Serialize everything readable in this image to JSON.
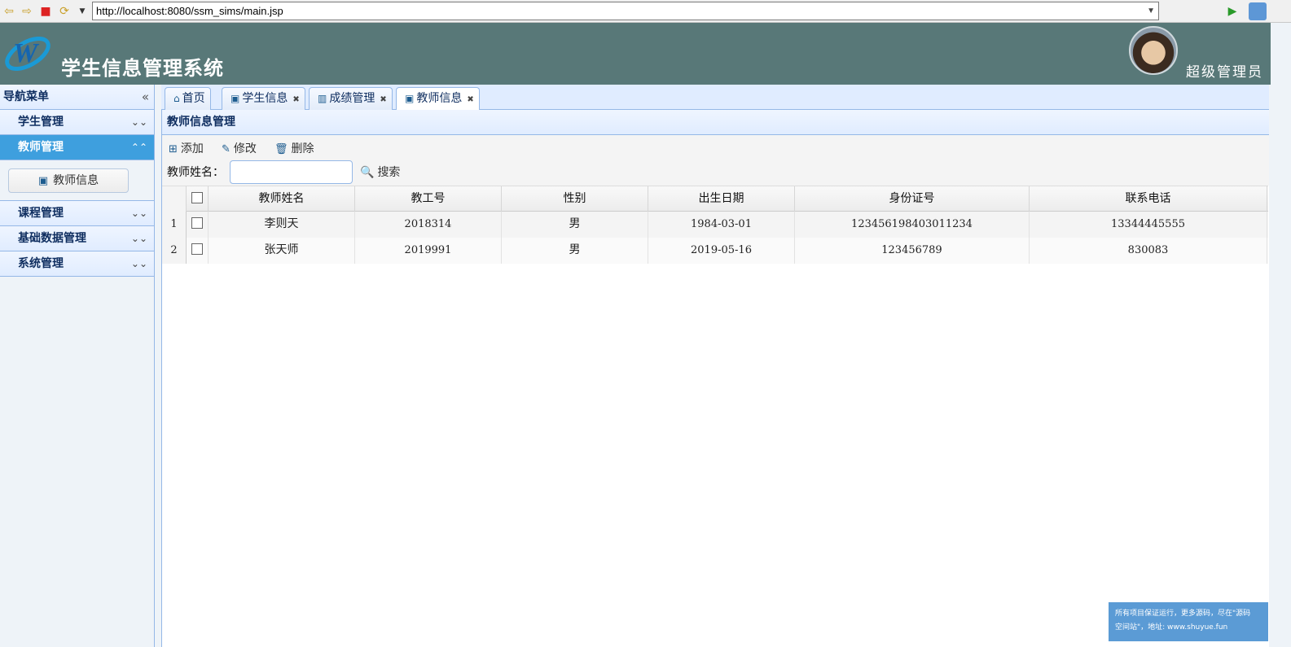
{
  "browser": {
    "url": "http://localhost:8080/ssm_sims/main.jsp"
  },
  "header": {
    "title": "学生信息管理系统",
    "user_role": "超级管理员"
  },
  "sidebar": {
    "title": "导航菜单",
    "groups": [
      {
        "label": "学生管理"
      },
      {
        "label": "教师管理",
        "items": [
          {
            "label": "教师信息"
          }
        ]
      },
      {
        "label": "课程管理"
      },
      {
        "label": "基础数据管理"
      },
      {
        "label": "系统管理"
      }
    ]
  },
  "tabs": [
    {
      "label": "首页"
    },
    {
      "label": "学生信息"
    },
    {
      "label": "成绩管理"
    },
    {
      "label": "教师信息"
    }
  ],
  "panel": {
    "title": "教师信息管理",
    "toolbar": {
      "add": "添加",
      "edit": "修改",
      "delete": "删除",
      "search_label": "教师姓名：",
      "search_value": "",
      "search_btn": "搜索"
    }
  },
  "grid": {
    "columns": [
      "教师姓名",
      "教工号",
      "性别",
      "出生日期",
      "身份证号",
      "联系电话"
    ],
    "rows": [
      {
        "n": "1",
        "name": "李则天",
        "id": "2018314",
        "gender": "男",
        "birth": "1984-03-01",
        "idcard": "123456198403011234",
        "phone": "13344445555"
      },
      {
        "n": "2",
        "name": "张天师",
        "id": "2019991",
        "gender": "男",
        "birth": "2019-05-16",
        "idcard": "123456789",
        "phone": "830083"
      }
    ]
  },
  "watermark": {
    "line1": "所有项目保证运行，更多源码，尽在\"源码",
    "line2": "空间站\"，地址: www.shuyue.fun"
  }
}
